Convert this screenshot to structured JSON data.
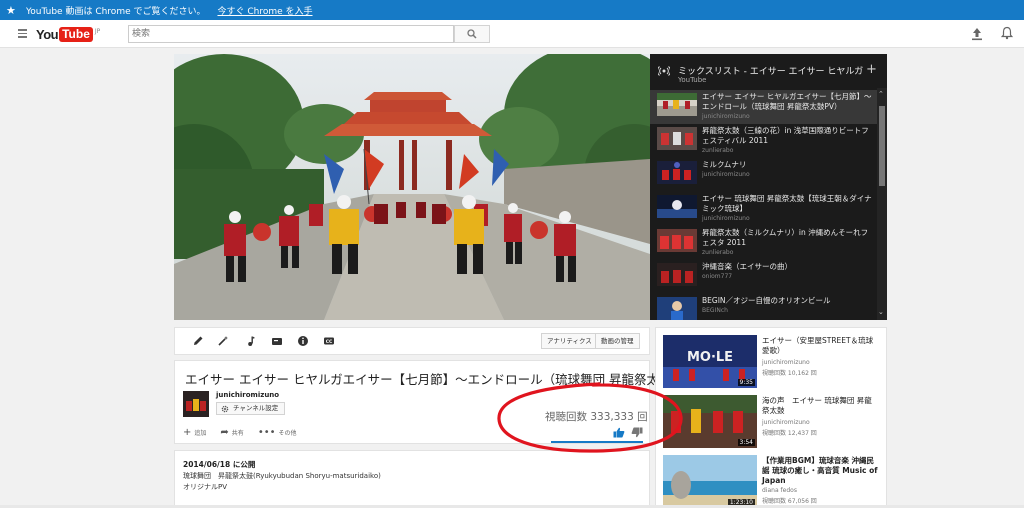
{
  "promo": {
    "text": "YouTube 動画は Chrome でご覧ください。",
    "link": "今すぐ Chrome を入手"
  },
  "masthead": {
    "logo_you": "You",
    "logo_tube": "Tube",
    "logo_region": "JP",
    "search_placeholder": "検索"
  },
  "playlist": {
    "title": "ミックスリスト - エイサー エイサー ヒヤルガエイサー【七月節】",
    "owner": "YouTube",
    "items": [
      {
        "title": "エイサー エイサー ヒヤルガエイサー【七月節】〜エンドロール（琉球舞団 昇龍祭太鼓PV）",
        "user": "junichiromizuno"
      },
      {
        "title": "昇龍祭太鼓（三線の花）in 浅草国際通りビートフェスティバル 2011",
        "user": "zunlierabo"
      },
      {
        "title": "ミルクムナリ",
        "user": "junichiromizuno"
      },
      {
        "title": "エイサー 琉球舞団 昇龍祭太鼓【琉球王朝＆ダイナミック琉球】",
        "user": "junichiromizuno"
      },
      {
        "title": "昇龍祭太鼓（ミルクムナリ）in 沖縄めんそーれフェスタ 2011",
        "user": "zunlierabo"
      },
      {
        "title": "沖縄音楽（エイサーの曲）",
        "user": "oniom777"
      },
      {
        "title": "BEGIN／オジー自慢のオリオンビール",
        "user": "BEGINch"
      }
    ]
  },
  "actionbar": {
    "analytics_label": "アナリティクス",
    "manage_label": "動画の管理"
  },
  "video": {
    "title": "エイサー エイサー ヒヤルガエイサー【七月節】〜エンドロール（琉球舞団 昇龍祭太鼓PV）",
    "owner": "junichiromizuno",
    "channel_settings": "チャンネル設定",
    "views": "視聴回数 333,333 回",
    "add_label": "追加",
    "share_label": "共有",
    "more_label": "その他"
  },
  "description": {
    "published": "2014/06/18 に公開",
    "line1": "琉球舞団　昇龍祭太鼓(Ryukyubudan Shoryu-matsuridaiko)",
    "line2": "オリジナルPV"
  },
  "related": [
    {
      "title": "エイサー（安里屋STREET＆琉球愛歌）",
      "user": "junichiromizuno",
      "views": "視聴回数 10,162 回",
      "duration": "9:35"
    },
    {
      "title": "海の声　エイサー 琉球舞団 昇龍祭太鼓",
      "user": "junichiromizuno",
      "views": "視聴回数 12,437 回",
      "duration": "3:54"
    },
    {
      "title": "【作業用BGM】琉球音楽 沖縄民謡 琉球の癒し・高音質 Music of Japan",
      "user": "diana fedos",
      "views": "視聴回数 67,056 回",
      "duration": "1:23:10"
    }
  ],
  "colors": {
    "accent_blue": "#167ac6",
    "youtube_red": "#e62117",
    "annotation_red": "#e0141e"
  }
}
